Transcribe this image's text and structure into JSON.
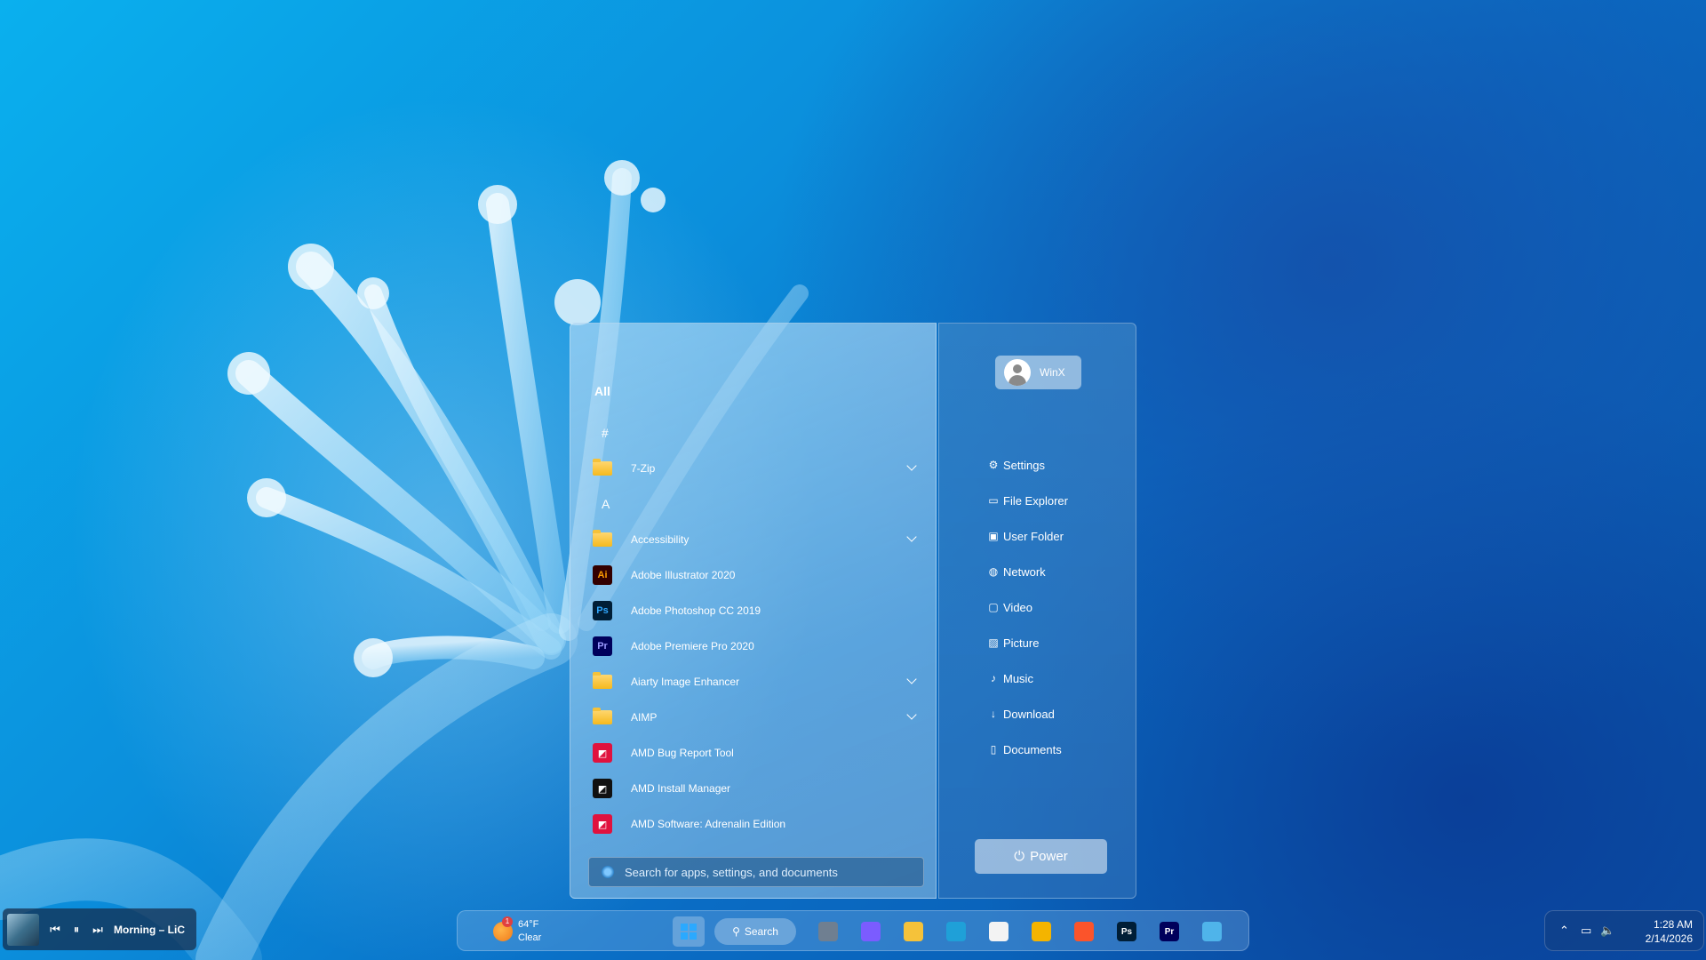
{
  "start_menu": {
    "heading": "All",
    "apps": [
      {
        "kind": "letter",
        "label": "#"
      },
      {
        "kind": "folder",
        "label": "7-Zip",
        "expandable": true
      },
      {
        "kind": "letter",
        "label": "A"
      },
      {
        "kind": "folder",
        "label": "Accessibility",
        "expandable": true
      },
      {
        "kind": "app",
        "label": "Adobe Illustrator 2020",
        "icon": "Ai",
        "icon_bg": "#330000",
        "icon_fg": "#ff9a00"
      },
      {
        "kind": "app",
        "label": "Adobe Photoshop CC 2019",
        "icon": "Ps",
        "icon_bg": "#001e36",
        "icon_fg": "#31a8ff"
      },
      {
        "kind": "app",
        "label": "Adobe Premiere Pro 2020",
        "icon": "Pr",
        "icon_bg": "#00005b",
        "icon_fg": "#9999ff"
      },
      {
        "kind": "folder",
        "label": "Aiarty Image Enhancer",
        "expandable": true
      },
      {
        "kind": "folder",
        "label": "AIMP",
        "expandable": true
      },
      {
        "kind": "app",
        "label": "AMD Bug Report Tool",
        "icon": "amd-icon",
        "icon_bg": "#e0123e",
        "icon_fg": "#ffffff"
      },
      {
        "kind": "app",
        "label": "AMD Install Manager",
        "icon": "amd-icon",
        "icon_bg": "#111111",
        "icon_fg": "#ffffff"
      },
      {
        "kind": "app",
        "label": "AMD Software: Adrenalin Edition",
        "icon": "amd-icon",
        "icon_bg": "#e0123e",
        "icon_fg": "#ffffff"
      }
    ],
    "search_placeholder": "Search for apps, settings, and documents",
    "user_name": "WinX",
    "places": [
      {
        "label": "Settings",
        "icon": "gear-icon"
      },
      {
        "label": "File Explorer",
        "icon": "folder-icon"
      },
      {
        "label": "User Folder",
        "icon": "user-folder-icon"
      },
      {
        "label": "Network",
        "icon": "network-icon"
      },
      {
        "label": "Video",
        "icon": "video-icon"
      },
      {
        "label": "Picture",
        "icon": "picture-icon"
      },
      {
        "label": "Music",
        "icon": "music-icon"
      },
      {
        "label": "Download",
        "icon": "download-icon"
      },
      {
        "label": "Documents",
        "icon": "document-icon"
      }
    ],
    "power_label": "Power"
  },
  "media": {
    "title": "Morning – LiC"
  },
  "taskbar": {
    "weather_temp": "64°F",
    "weather_desc": "Clear",
    "weather_badge": "1",
    "search_label": "Search",
    "pinned": [
      {
        "name": "task-view",
        "label": "",
        "bg": "#6f7f91"
      },
      {
        "name": "copilot",
        "label": "",
        "bg": "#7b5cff"
      },
      {
        "name": "file-explorer",
        "label": "",
        "bg": "#f5c23a"
      },
      {
        "name": "edge",
        "label": "",
        "bg": "#1fa0d8"
      },
      {
        "name": "microsoft-store",
        "label": "",
        "bg": "#f3f3f3"
      },
      {
        "name": "chrome",
        "label": "",
        "bg": "#f4b400"
      },
      {
        "name": "brave",
        "label": "",
        "bg": "#fb542b"
      },
      {
        "name": "photoshop",
        "label": "Ps",
        "bg": "#001e36"
      },
      {
        "name": "premiere",
        "label": "Pr",
        "bg": "#00005b"
      },
      {
        "name": "notepad",
        "label": "",
        "bg": "#4fb4ea"
      }
    ]
  },
  "tray": {
    "time": "1:28 AM",
    "date": "2/14/2026"
  }
}
